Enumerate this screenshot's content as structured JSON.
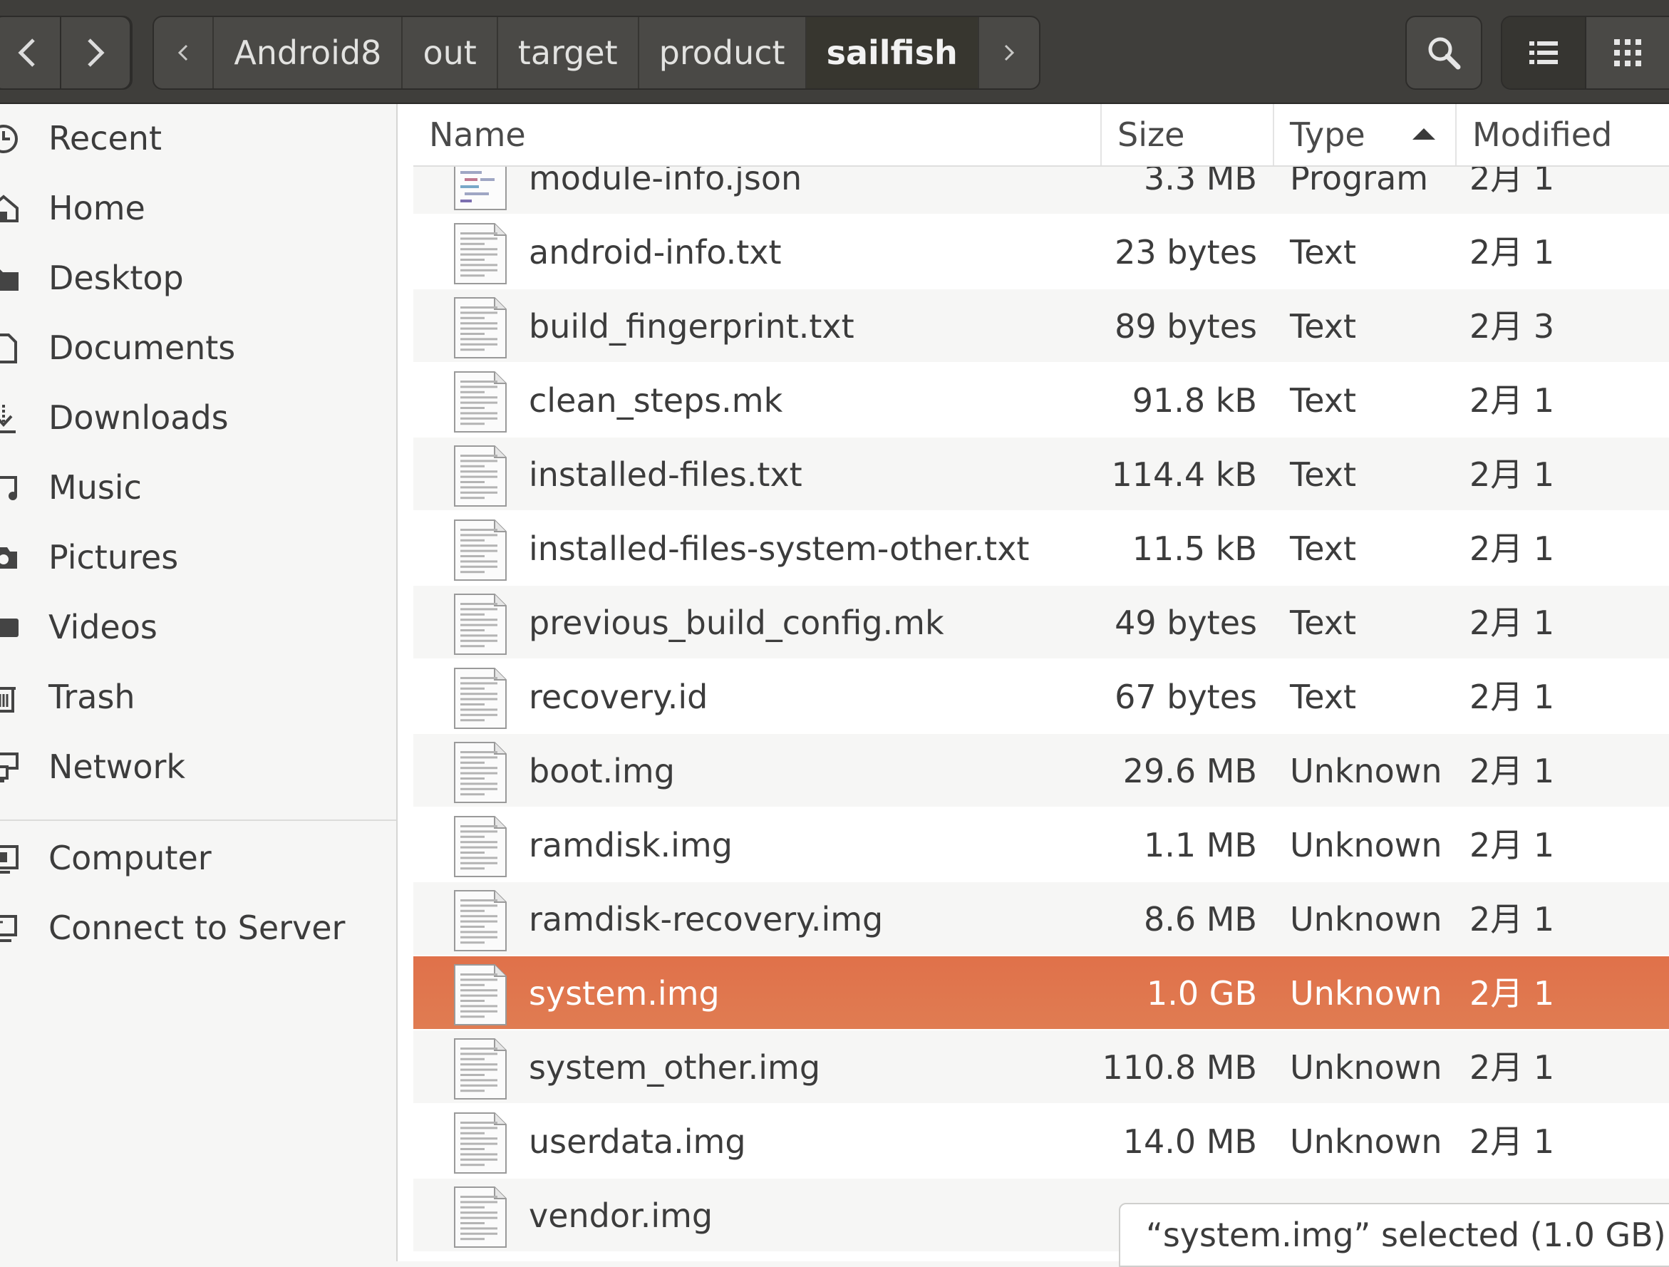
{
  "pathbar": {
    "crumbs": [
      "Android8",
      "out",
      "target",
      "product",
      "sailfish"
    ]
  },
  "sidebar": {
    "items": [
      {
        "label": "Recent",
        "icon": "clock-icon"
      },
      {
        "label": "Home",
        "icon": "home-icon"
      },
      {
        "label": "Desktop",
        "icon": "folder-icon"
      },
      {
        "label": "Documents",
        "icon": "document-icon"
      },
      {
        "label": "Downloads",
        "icon": "download-icon"
      },
      {
        "label": "Music",
        "icon": "music-icon"
      },
      {
        "label": "Pictures",
        "icon": "camera-icon"
      },
      {
        "label": "Videos",
        "icon": "video-icon"
      },
      {
        "label": "Trash",
        "icon": "trash-icon"
      },
      {
        "label": "Network",
        "icon": "network-icon"
      },
      {
        "label": "Computer",
        "icon": "computer-icon"
      },
      {
        "label": "Connect to Server",
        "icon": "server-icon"
      }
    ]
  },
  "columns": {
    "name": "Name",
    "size": "Size",
    "type": "Type",
    "modified": "Modified"
  },
  "files": [
    {
      "name": "module-info.json",
      "size": "3.3 MB",
      "type": "Program",
      "modified": "2月 1",
      "icon": "code-file-icon"
    },
    {
      "name": "android-info.txt",
      "size": "23 bytes",
      "type": "Text",
      "modified": "2月 1",
      "icon": "text-file-icon"
    },
    {
      "name": "build_fingerprint.txt",
      "size": "89 bytes",
      "type": "Text",
      "modified": "2月 3",
      "icon": "text-file-icon"
    },
    {
      "name": "clean_steps.mk",
      "size": "91.8 kB",
      "type": "Text",
      "modified": "2月 1",
      "icon": "text-file-icon"
    },
    {
      "name": "installed-files.txt",
      "size": "114.4 kB",
      "type": "Text",
      "modified": "2月 1",
      "icon": "text-file-icon"
    },
    {
      "name": "installed-files-system-other.txt",
      "size": "11.5 kB",
      "type": "Text",
      "modified": "2月 1",
      "icon": "text-file-icon"
    },
    {
      "name": "previous_build_config.mk",
      "size": "49 bytes",
      "type": "Text",
      "modified": "2月 1",
      "icon": "text-file-icon"
    },
    {
      "name": "recovery.id",
      "size": "67 bytes",
      "type": "Text",
      "modified": "2月 1",
      "icon": "text-file-icon"
    },
    {
      "name": "boot.img",
      "size": "29.6 MB",
      "type": "Unknown",
      "modified": "2月 1",
      "icon": "text-file-icon"
    },
    {
      "name": "ramdisk.img",
      "size": "1.1 MB",
      "type": "Unknown",
      "modified": "2月 1",
      "icon": "text-file-icon"
    },
    {
      "name": "ramdisk-recovery.img",
      "size": "8.6 MB",
      "type": "Unknown",
      "modified": "2月 1",
      "icon": "text-file-icon"
    },
    {
      "name": "system.img",
      "size": "1.0 GB",
      "type": "Unknown",
      "modified": "2月 1",
      "icon": "text-file-icon",
      "selected": true
    },
    {
      "name": "system_other.img",
      "size": "110.8 MB",
      "type": "Unknown",
      "modified": "2月 1",
      "icon": "text-file-icon"
    },
    {
      "name": "userdata.img",
      "size": "14.0 MB",
      "type": "Unknown",
      "modified": "2月 1",
      "icon": "text-file-icon"
    },
    {
      "name": "vendor.img",
      "size": "",
      "type": "",
      "modified": "",
      "icon": "text-file-icon"
    }
  ],
  "status": {
    "text": "“system.img” selected  (1.0 GB)"
  },
  "colors": {
    "headerbar": "#3f3e3b",
    "selection": "#e07a50"
  }
}
